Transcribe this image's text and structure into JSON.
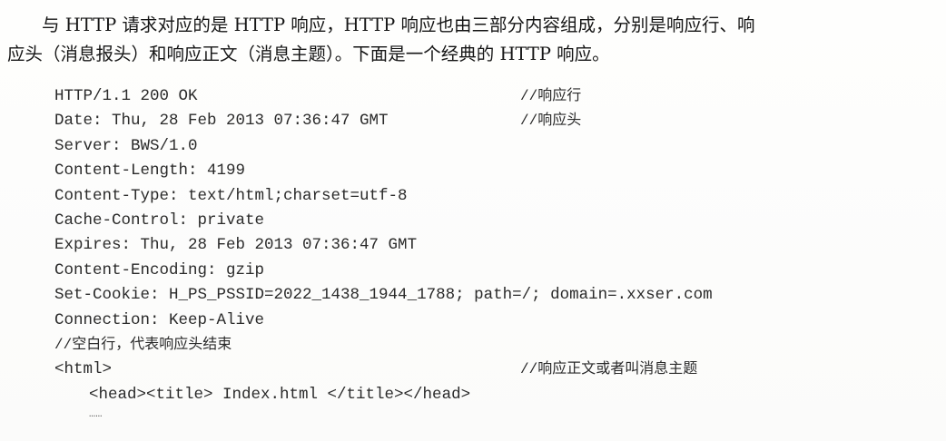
{
  "paragraph": {
    "line1": "与 HTTP 请求对应的是 HTTP 响应，HTTP 响应也由三部分内容组成，分别是响应行、响",
    "line2": "应头（消息报头）和响应正文（消息主题）。下面是一个经典的 HTTP 响应。"
  },
  "code": {
    "status_line": "HTTP/1.1 200 OK",
    "status_comment": "//响应行",
    "date": "Date: Thu, 28 Feb 2013 07:36:47 GMT",
    "headers_comment": "//响应头",
    "server": "Server: BWS/1.0",
    "content_length": "Content-Length: 4199",
    "content_type": "Content-Type: text/html;charset=utf-8",
    "cache_control": "Cache-Control: private",
    "expires": "Expires: Thu, 28 Feb 2013 07:36:47 GMT",
    "content_encoding": "Content-Encoding: gzip",
    "set_cookie": "Set-Cookie: H_PS_PSSID=2022_1438_1944_1788; path=/; domain=.xxser.com",
    "connection": "Connection: Keep-Alive",
    "blank_line_comment": "//空白行，代表响应头结束",
    "html_open": "<html>",
    "body_comment": "//响应正文或者叫消息主题",
    "head_line": "<head><title> Index.html </title></head>",
    "ellipsis": "……"
  }
}
